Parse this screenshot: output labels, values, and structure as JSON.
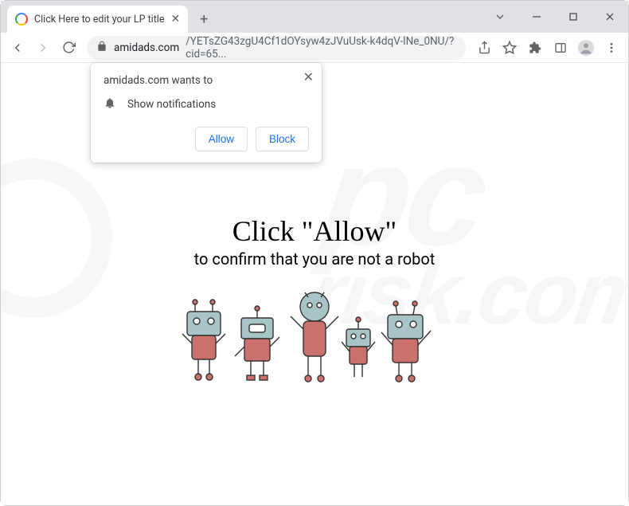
{
  "window": {
    "tab_title": "Click Here to edit your LP title"
  },
  "toolbar": {
    "url_host": "amidads.com",
    "url_path": "/YETsZG43zgU4Cf1dOYsyw4zJVuUsk-k4dqV-lNe_0NU/?cid=65..."
  },
  "permission": {
    "origin_text": "amidads.com wants to",
    "request_label": "Show notifications",
    "allow_label": "Allow",
    "block_label": "Block"
  },
  "page": {
    "headline": "Click \"Allow\"",
    "subline": "to confirm that you are not a robot"
  },
  "watermark": {
    "line1": "pc",
    "line2": "risk.com"
  }
}
